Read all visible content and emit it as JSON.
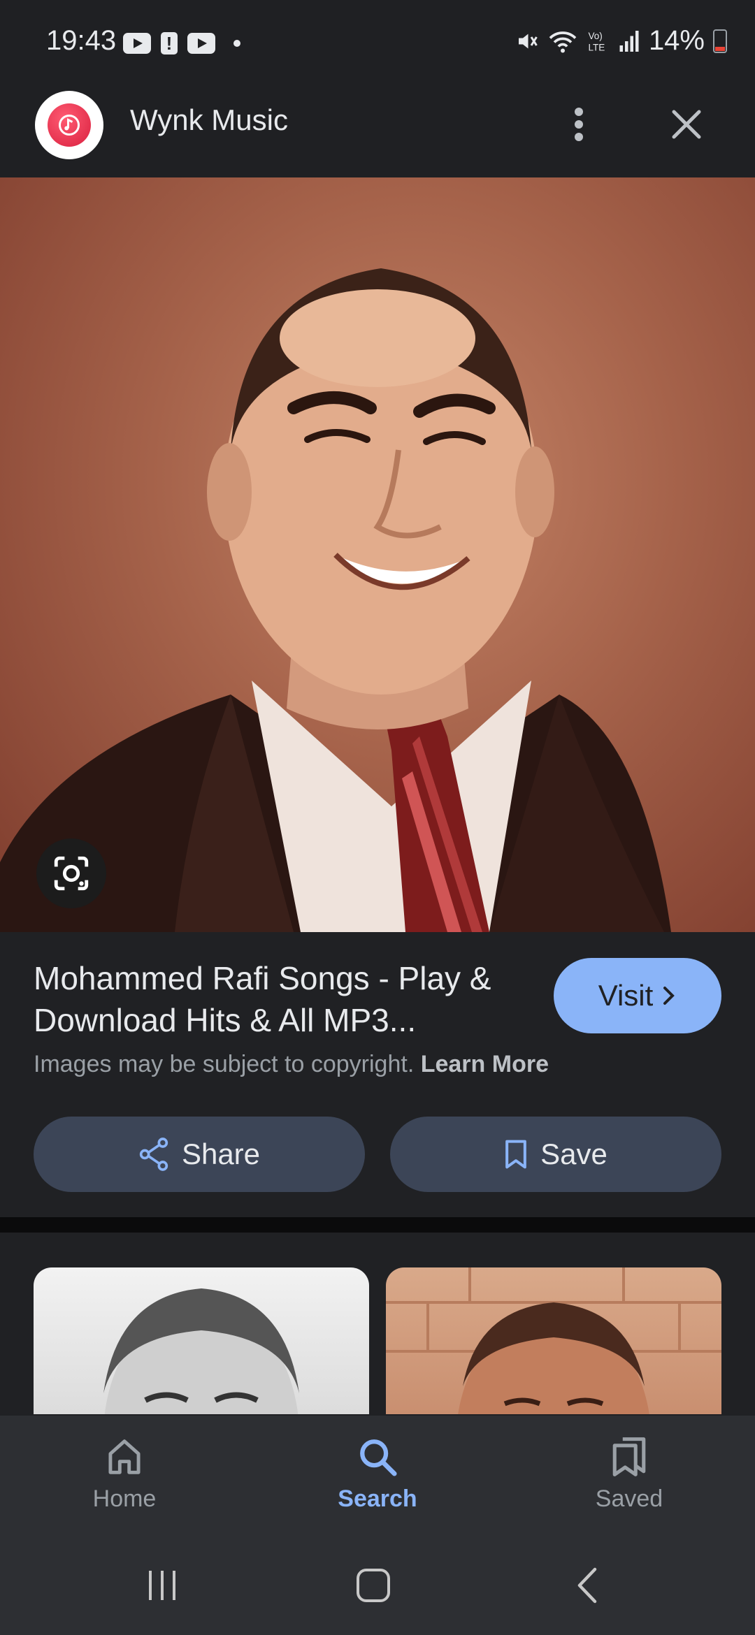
{
  "status_bar": {
    "time": "19:43",
    "battery": "14%"
  },
  "header": {
    "app_name": "Wynk Music"
  },
  "result": {
    "title": "Mohammed Rafi Songs - Play & Download Hits & All MP3...",
    "visit_label": "Visit",
    "copyright_text": "Images may be subject to copyright.",
    "learn_more": "Learn More",
    "share_label": "Share",
    "save_label": "Save"
  },
  "bottom_nav": {
    "items": [
      {
        "label": "Home",
        "icon": "home-icon"
      },
      {
        "label": "Search",
        "icon": "search-icon"
      },
      {
        "label": "Saved",
        "icon": "saved-icon"
      }
    ],
    "active": "Search"
  },
  "colors": {
    "accent": "#8ab4f8",
    "background": "#202124",
    "pill_button": "#3c4557"
  }
}
